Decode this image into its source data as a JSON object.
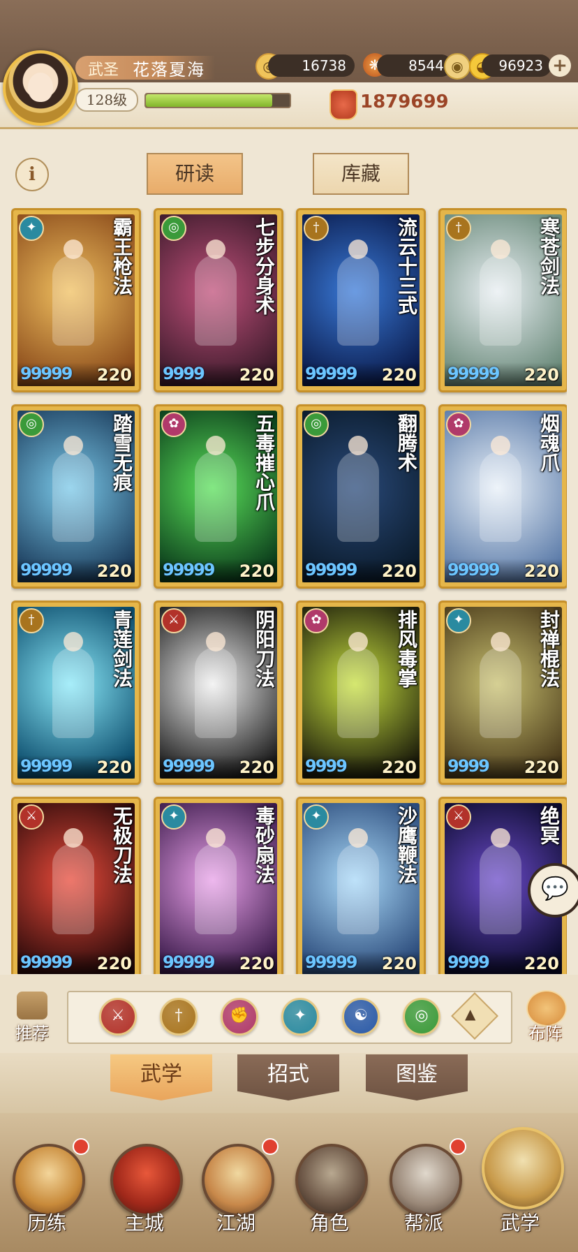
{
  "player": {
    "title": "武圣",
    "name": "花落夏海",
    "level": "128级",
    "xp_fraction": 0.88,
    "power": "1879699"
  },
  "resources": {
    "coins": "16738",
    "materials": "8544",
    "gold": "96923"
  },
  "tabs": {
    "study": "研读",
    "storage": "库藏"
  },
  "colors": {
    "school_teal": "#2a8aa0",
    "school_green": "#3a9a3a",
    "school_gold": "#a8741e",
    "school_pink": "#b03a6a",
    "school_red": "#b2322a",
    "school_blue": "#2a5aa8"
  },
  "cards": [
    {
      "name": "霸王枪法",
      "level": "220",
      "pips": 5,
      "school": "teal",
      "bg": [
        "#f0c060",
        "#8a4a1a"
      ]
    },
    {
      "name": "七步分身术",
      "level": "220",
      "pips": 4,
      "school": "green",
      "bg": [
        "#c0507a",
        "#3a1a2a"
      ]
    },
    {
      "name": "流云十三式",
      "level": "220",
      "pips": 5,
      "school": "gold",
      "bg": [
        "#3a7ad8",
        "#0a1a4a"
      ]
    },
    {
      "name": "寒苍剑法",
      "level": "220",
      "pips": 5,
      "school": "gold",
      "bg": [
        "#e8eef2",
        "#6a8a7a"
      ]
    },
    {
      "name": "踏雪无痕",
      "level": "220",
      "pips": 5,
      "school": "green",
      "bg": [
        "#7ac8e8",
        "#1a3a5a"
      ]
    },
    {
      "name": "五毒摧心爪",
      "level": "220",
      "pips": 5,
      "school": "pink",
      "bg": [
        "#5ae05a",
        "#0a3a1a"
      ]
    },
    {
      "name": "翻腾术",
      "level": "220",
      "pips": 5,
      "school": "green",
      "bg": [
        "#2a4a7a",
        "#0a1a2a"
      ]
    },
    {
      "name": "烟魂爪",
      "level": "220",
      "pips": 5,
      "school": "pink",
      "bg": [
        "#e8f0f8",
        "#5a7aa8"
      ]
    },
    {
      "name": "青莲剑法",
      "level": "220",
      "pips": 5,
      "school": "gold",
      "bg": [
        "#8ae8f8",
        "#0a4a6a"
      ]
    },
    {
      "name": "阴阳刀法",
      "level": "220",
      "pips": 5,
      "school": "red",
      "bg": [
        "#f0f0f0",
        "#1a1a1a"
      ]
    },
    {
      "name": "排风毒掌",
      "level": "220",
      "pips": 4,
      "school": "pink",
      "bg": [
        "#c8e040",
        "#1a1a0a"
      ]
    },
    {
      "name": "封禅棍法",
      "level": "220",
      "pips": 4,
      "school": "teal",
      "bg": [
        "#c8c070",
        "#4a3a1a"
      ]
    },
    {
      "name": "无极刀法",
      "level": "220",
      "pips": 5,
      "school": "red",
      "bg": [
        "#e84a3a",
        "#2a0a0a"
      ]
    },
    {
      "name": "毒砂扇法",
      "level": "220",
      "pips": 5,
      "school": "teal",
      "bg": [
        "#e8a0e8",
        "#3a1a4a"
      ]
    },
    {
      "name": "沙鹰鞭法",
      "level": "220",
      "pips": 5,
      "school": "teal",
      "bg": [
        "#a8d8f8",
        "#2a4a7a"
      ]
    },
    {
      "name": "绝冥",
      "level": "220",
      "pips": 4,
      "school": "red",
      "bg": [
        "#6a4ac8",
        "#0a0a2a"
      ]
    }
  ],
  "filters": {
    "recommend": "推荐",
    "formation": "布阵",
    "schools": [
      {
        "icon": "saber-icon",
        "color": "#b2322a"
      },
      {
        "icon": "sword-icon",
        "color": "#a8741e"
      },
      {
        "icon": "fist-icon",
        "color": "#b03a6a"
      },
      {
        "icon": "fan-icon",
        "color": "#2a8aa0"
      },
      {
        "icon": "yin-yang-icon",
        "color": "#2a5aa8"
      },
      {
        "icon": "swirl-icon",
        "color": "#3a9a3a"
      }
    ]
  },
  "sub_tabs": {
    "martial": "武学",
    "moves": "招式",
    "codex": "图鉴"
  },
  "nav": [
    {
      "label": "历练",
      "dot": true
    },
    {
      "label": "主城",
      "dot": false
    },
    {
      "label": "江湖",
      "dot": true
    },
    {
      "label": "角色",
      "dot": false
    },
    {
      "label": "帮派",
      "dot": true
    },
    {
      "label": "武学",
      "dot": false
    }
  ]
}
